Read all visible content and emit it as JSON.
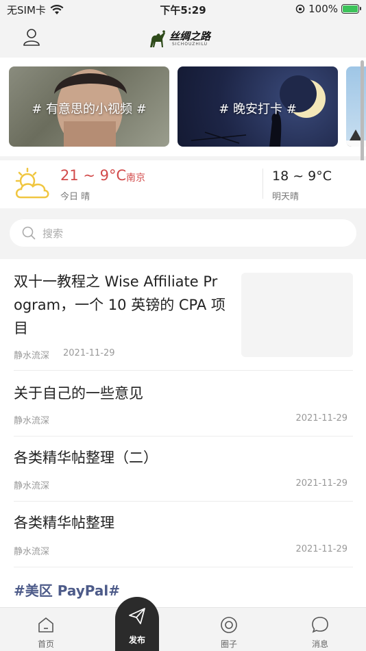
{
  "status_bar": {
    "carrier": "无SIM卡",
    "time": "下午5:29",
    "battery": "100%"
  },
  "header": {
    "logo_text": "丝绸之路",
    "logo_sub": "SICHOUZHILU"
  },
  "banner": {
    "cards": [
      {
        "caption": "# 有意思的小视频 #"
      },
      {
        "caption": "# 晚安打卡 #"
      }
    ]
  },
  "weather": {
    "today_temp": "21 ~ 9°C",
    "city": "南京",
    "today_desc": "今日 晴",
    "tomorrow_temp": "18 ~ 9°C",
    "tomorrow_desc": "明天晴"
  },
  "search": {
    "placeholder": "搜索"
  },
  "feed": {
    "posts": [
      {
        "title_line1": "双十一教程之 Wise Affiliate Pr",
        "title_line2": "ogram，一个 10 英镑的 CPA 项",
        "title_line3": "目",
        "author": "静水流深",
        "date": "2021-11-29"
      },
      {
        "title": "关于自己的一些意见",
        "author": "静水流深",
        "date": "2021-11-29"
      },
      {
        "title": "各类精华帖整理（二）",
        "author": "静水流深",
        "date": "2021-11-29"
      },
      {
        "title": "各类精华帖整理",
        "author": "静水流深",
        "date": "2021-11-29"
      }
    ],
    "hashtag": "#美区 PayPal#"
  },
  "tabbar": {
    "home": "首页",
    "publish": "发布",
    "circle": "圈子",
    "messages": "消息"
  }
}
